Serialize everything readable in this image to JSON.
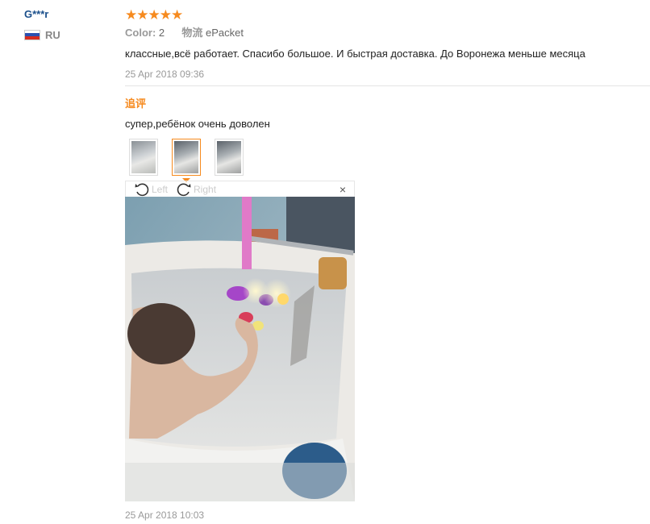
{
  "user": {
    "name": "G***r",
    "country": "RU"
  },
  "review": {
    "rating": 5,
    "color_label": "Color:",
    "color_value": "2",
    "shipping_label": "物流",
    "shipping_value": "ePacket",
    "text": "классные,всё работает. Спасибо большое. И быстрая доставка. До Воронежа меньше месяца",
    "date": "25 Apr 2018 09:36"
  },
  "additional": {
    "label": "追评",
    "text": "супер,ребёнок очень доволен",
    "date": "25 Apr 2018 10:03"
  },
  "viewer": {
    "left_label": "Left",
    "right_label": "Right",
    "close": "×"
  },
  "colors": {
    "accent": "#f68a1e",
    "username": "#1a4f8b"
  }
}
